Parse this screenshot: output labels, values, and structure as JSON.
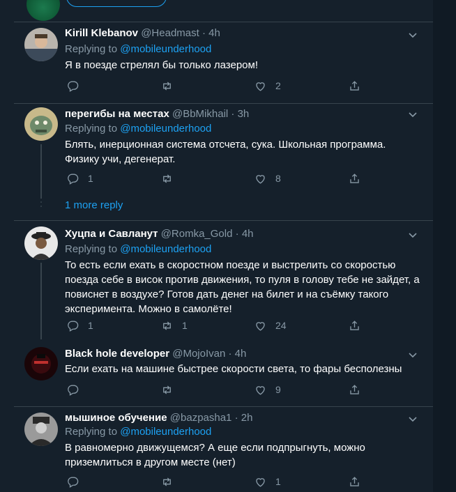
{
  "more_replies_label": "1 more reply",
  "replying_prefix": "Replying to",
  "tweets": [
    {
      "name": "Kirill Klebanov",
      "handle": "@Headmast",
      "time": "4h",
      "replying_to": "@mobileunderhood",
      "text": "Я в поезде стрелял бы только лазером!",
      "replies": "",
      "retweets": "",
      "likes": "2",
      "avatar_colors": [
        "#b9b4ad",
        "#3c4a5a"
      ]
    },
    {
      "name": "перегибы на местах",
      "handle": "@BbMikhail",
      "time": "3h",
      "replying_to": "@mobileunderhood",
      "text": "Блять, инерционная система отсчета, сука. Школьная программа. Физику учи, дегенерат.",
      "replies": "1",
      "retweets": "",
      "likes": "8",
      "avatar_colors": [
        "#6e8a6a",
        "#c8b98a"
      ]
    },
    {
      "name": "Хуцпа и Савланут",
      "handle": "@Romka_Gold",
      "time": "4h",
      "replying_to": "@mobileunderhood",
      "text": "То есть если ехать в скоростном поезде и выстрелить со скоростью поезда себе в висок против движения, то пуля в голову тебе не зайдет, а повиснет в воздухе? Готов дать денег на билет и на съёмку такого эксперимента. Можно в самолёте!",
      "replies": "1",
      "retweets": "1",
      "likes": "24",
      "avatar_colors": [
        "#e8e8e8",
        "#222222"
      ]
    },
    {
      "name": "Black hole developer",
      "handle": "@MojoIvan",
      "time": "4h",
      "replying_to": "",
      "text": "Если ехать на машине быстрее скорости света, то фары бесполезны",
      "replies": "",
      "retweets": "",
      "likes": "9",
      "avatar_colors": [
        "#3a0a0e",
        "#c0302e"
      ]
    },
    {
      "name": "мышиное обучение",
      "handle": "@bazpasha1",
      "time": "2h",
      "replying_to": "@mobileunderhood",
      "text": "В равномерно движущемся? А еще если подпрыгнуть, можно приземлиться в другом месте (нет)",
      "replies": "",
      "retweets": "",
      "likes": "1",
      "avatar_colors": [
        "#9a9a9a",
        "#2a2a2a"
      ]
    }
  ]
}
